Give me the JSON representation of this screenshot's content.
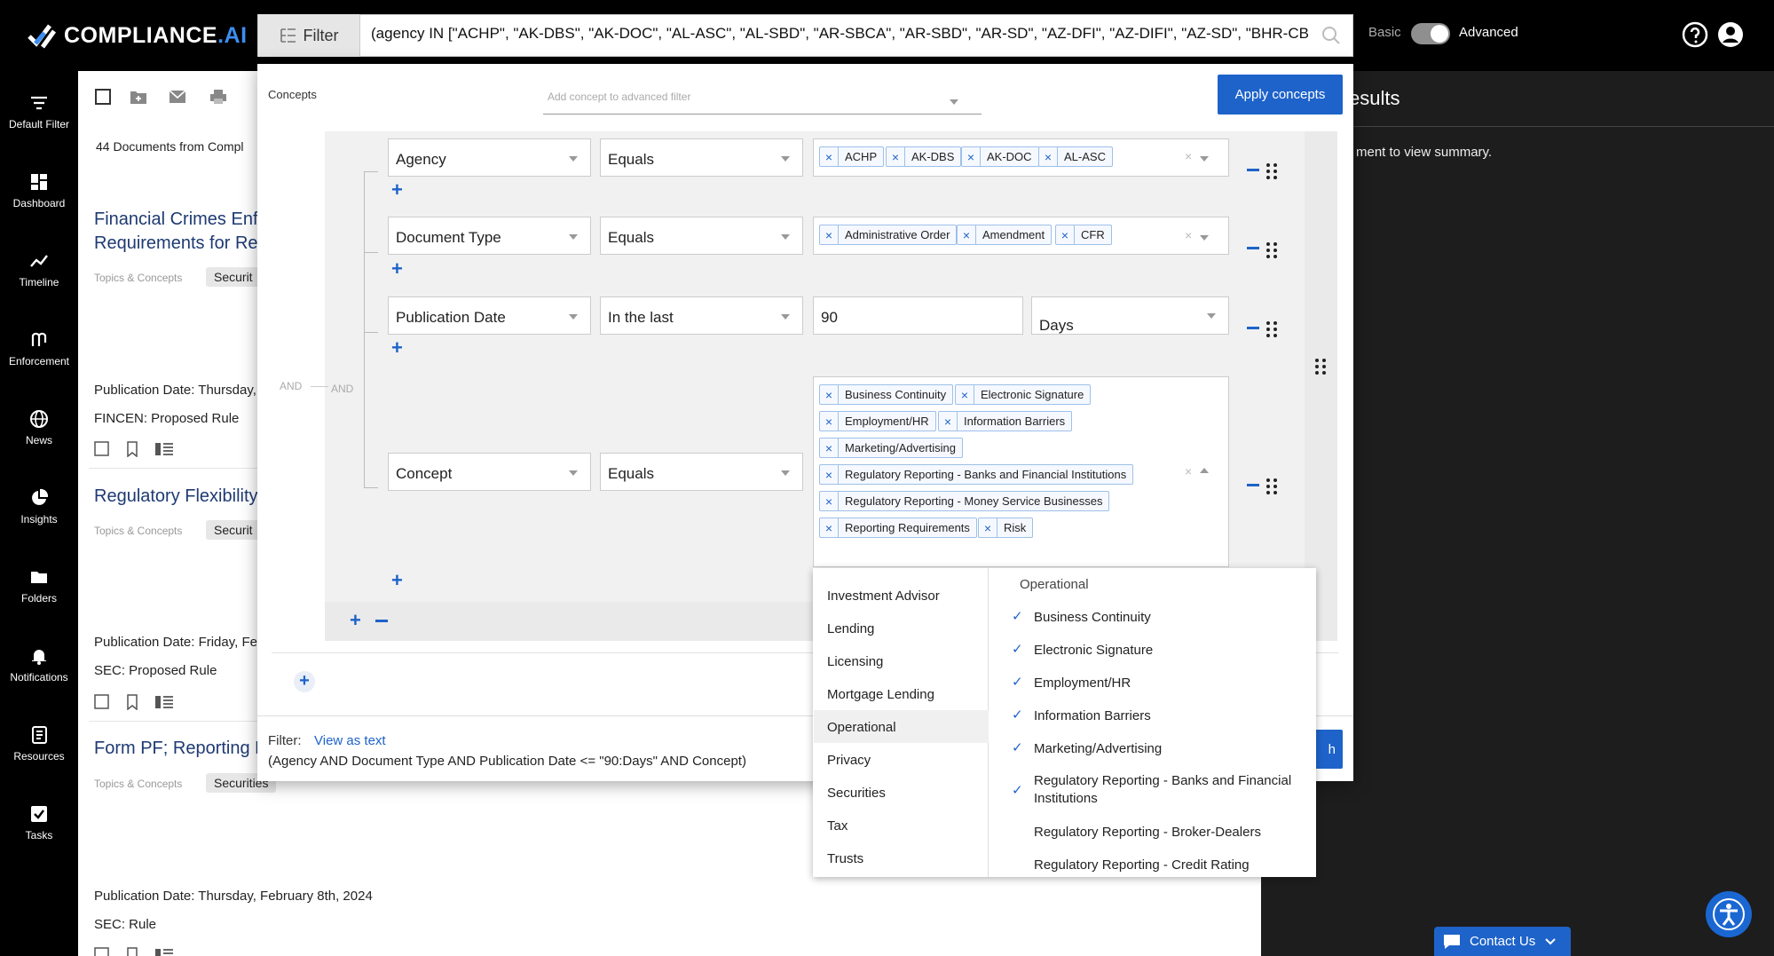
{
  "app": {
    "brand": "COMPLIANCE",
    "brand_suffix": ".AI"
  },
  "topbar": {
    "filter_label": "Filter",
    "query": "(agency IN [\"ACHP\", \"AK-DBS\", \"AK-DOC\", \"AL-ASC\", \"AL-SBD\", \"AR-SBCA\", \"AR-SBD\", \"AR-SD\", \"AZ-DFI\", \"AZ-DIFI\", \"AZ-SD\", \"BHR-CBB\", \"BHR-",
    "mode_basic": "Basic",
    "mode_advanced": "Advanced",
    "mode": "Advanced"
  },
  "sidebar": {
    "items": [
      {
        "label": "Default Filter",
        "icon": "filter-icon"
      },
      {
        "label": "Dashboard",
        "icon": "dashboard-icon"
      },
      {
        "label": "Timeline",
        "icon": "timeline-icon"
      },
      {
        "label": "Enforcement",
        "icon": "enforcement-icon"
      },
      {
        "label": "News",
        "icon": "globe-icon"
      },
      {
        "label": "Insights",
        "icon": "pie-icon"
      },
      {
        "label": "Folders",
        "icon": "folder-icon"
      },
      {
        "label": "Notifications",
        "icon": "bell-icon"
      },
      {
        "label": "Resources",
        "icon": "resources-icon"
      },
      {
        "label": "Tasks",
        "icon": "tasks-icon"
      }
    ]
  },
  "doclist": {
    "count_text": "44 Documents from Compl",
    "docs": [
      {
        "title1": "Financial Crimes Enfo",
        "title2": "Requirements for Reg",
        "topics": "Topics & Concepts",
        "chip": "Securit",
        "date": "Publication Date: Thursday,",
        "type": "FINCEN:  Proposed Rule"
      },
      {
        "title1": "Regulatory Flexibility",
        "title2": "",
        "topics": "Topics & Concepts",
        "chip": "Securit",
        "date": "Publication Date: Friday, Fe",
        "type": "SEC:  Proposed Rule"
      },
      {
        "title1": "Form PF; Reporting R",
        "title2": "",
        "topics": "Topics & Concepts",
        "chip": "Securities",
        "date": "Publication Date: Thursday, February 8th, 2024",
        "type": "SEC:  Rule"
      }
    ]
  },
  "right_panel": {
    "title": "esults",
    "text": "ment to view summary."
  },
  "contact": {
    "label": "Contact Us"
  },
  "modal": {
    "concepts_label": "Concepts",
    "concept_placeholder": "Add concept to advanced filter",
    "apply_label": "Apply concepts",
    "and_outer": "AND",
    "and_inner": "AND",
    "rows": [
      {
        "field": "Agency",
        "operator": "Equals",
        "tags": [
          "ACHP",
          "AK-DBS",
          "AK-DOC",
          "AL-ASC"
        ]
      },
      {
        "field": "Document Type",
        "operator": "Equals",
        "tags": [
          "Administrative Order",
          "Amendment",
          "CFR"
        ]
      },
      {
        "field": "Publication Date",
        "operator": "In the last",
        "value": "90",
        "unit": "Days"
      },
      {
        "field": "Concept",
        "operator": "Equals",
        "tags": [
          "Business Continuity",
          "Electronic Signature",
          "Employment/HR",
          "Information Barriers",
          "Marketing/Advertising",
          "Regulatory Reporting - Banks and Financial Institutions",
          "Regulatory Reporting - Money Service Businesses",
          "Reporting Requirements",
          "Risk"
        ]
      }
    ],
    "footer": {
      "filter_label": "Filter:",
      "view_as_text": "View as text",
      "expression": "(Agency AND Document Type AND Publication Date <= \"90:Days\" AND Concept)",
      "search_label": "h"
    }
  },
  "dropdown": {
    "categories": [
      "Investment Advisor",
      "Lending",
      "Licensing",
      "Mortgage Lending",
      "Operational",
      "Privacy",
      "Securities",
      "Tax",
      "Trusts"
    ],
    "selected_category": "Operational",
    "header": "Operational",
    "options": [
      {
        "label": "Business Continuity",
        "checked": true
      },
      {
        "label": "Electronic Signature",
        "checked": true
      },
      {
        "label": "Employment/HR",
        "checked": true
      },
      {
        "label": "Information Barriers",
        "checked": true
      },
      {
        "label": "Marketing/Advertising",
        "checked": true
      },
      {
        "label": "Regulatory Reporting - Banks and Financial Institutions",
        "checked": true
      },
      {
        "label": "Regulatory Reporting - Broker-Dealers",
        "checked": false
      },
      {
        "label": "Regulatory Reporting - Credit Rating",
        "checked": false
      }
    ]
  },
  "colors": {
    "accent": "#1e63c9",
    "brand_ai": "#3c8ef0",
    "sidebar_bg": "#000000",
    "panel_bg": "#1d1d1d"
  }
}
